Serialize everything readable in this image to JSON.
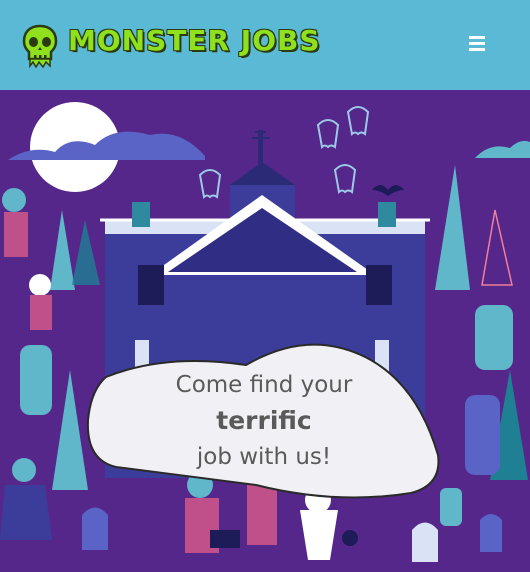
{
  "header": {
    "brand": "MONSTER JOBS",
    "logo_icon": "skull-icon",
    "menu_icon": "hamburger-menu-icon",
    "background_color": "#5ab9d4",
    "brand_color": "#8fe11d"
  },
  "hero": {
    "background_color": "#55278a",
    "illustration": "haunted-mansion-illustration",
    "bubble": {
      "line1": "Come find your",
      "line2": "terrific",
      "line3": "job with us!"
    }
  }
}
